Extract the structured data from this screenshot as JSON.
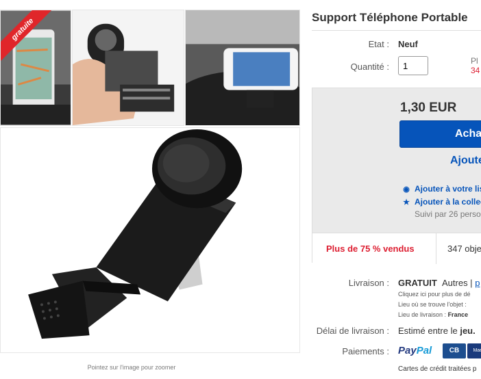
{
  "gallery": {
    "ribbon": "gratuite",
    "zoom_hint": "Pointez sur l'image pour zoomer"
  },
  "product": {
    "title": "Support Téléphone Portable",
    "state_label": "Etat :",
    "state_value": "Neuf",
    "qty_label": "Quantité :",
    "qty_value": "1",
    "avail_line1": "Pl",
    "avail_line2": "34"
  },
  "buybox": {
    "price": "1,30 EUR",
    "buy_label": "Acha",
    "add_cart_label": "Ajoute",
    "watch_label": "Ajouter à votre lis",
    "collection_label": "Ajouter à la collec",
    "followers": "Suivi par 26 perso",
    "sold_pct": "Plus de 75 % vendus",
    "sold_count": "347 obje"
  },
  "shipping": {
    "label": "Livraison :",
    "free": "GRATUIT",
    "other": "Autres |",
    "other_link": "p",
    "note1": "Cliquez ici pour plus de dé",
    "note2": "Lieu où se trouve l'objet :",
    "note3_label": "Lieu de livraison :",
    "note3_value": "France"
  },
  "delay": {
    "label": "Délai de livraison :",
    "value_prefix": "Estimé entre le",
    "value_bold": "jeu."
  },
  "payments": {
    "label": "Paiements :",
    "paypal_1": "Pay",
    "paypal_2": "Pal",
    "cb": "CB",
    "mc": "Maes",
    "note": "Cartes de crédit traitées p"
  },
  "colors": {
    "accent_blue": "#0654ba",
    "sold_red": "#dd1e31",
    "ribbon_red": "#e0262a",
    "buybox_bg": "#eaeaea"
  },
  "icons": [
    "eye-icon",
    "star-icon"
  ]
}
